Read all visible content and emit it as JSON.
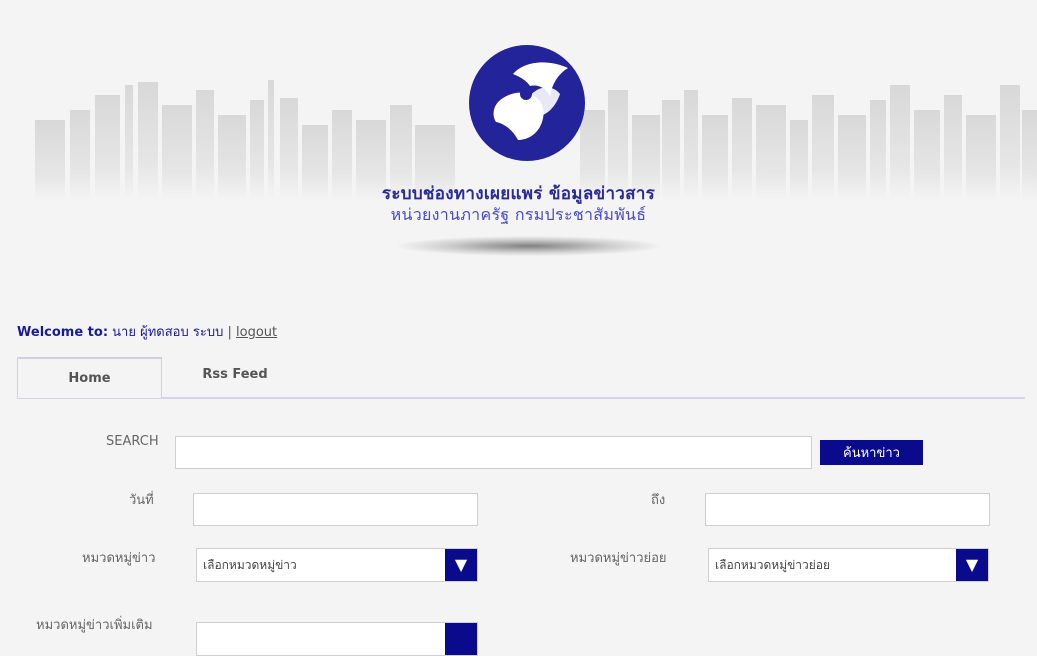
{
  "header": {
    "title_line1": "ระบบช่องทางเผยแพร่ ข้อมูลข่าวสาร",
    "title_line2": "หน่วยงานภาครัฐ กรมประชาสัมพันธ์",
    "brand_color": "#23239a"
  },
  "welcome": {
    "label": "Welcome to:",
    "user": "นาย ผู้ทดสอบ ระบบ",
    "separator": "|",
    "logout": "logout"
  },
  "tabs": [
    {
      "label": "Home",
      "active": true
    },
    {
      "label": "Rss Feed",
      "active": false
    }
  ],
  "search": {
    "label": "SEARCH",
    "value": "",
    "button_label": "ค้นหาข่าว"
  },
  "date": {
    "from_label": "วันที่",
    "from_value": "",
    "to_label": "ถึง",
    "to_value": ""
  },
  "category": {
    "label": "หมวดหมู่ข่าว",
    "selected": "เลือกหมวดหมู่ข่าว"
  },
  "subcategory": {
    "label": "หมวดหมู่ข่าวย่อย",
    "selected": "เลือกหมวดหมู่ข่าวย่อย"
  },
  "extra": {
    "label": "หมวดหมู่ข่าวเพิ่มเติม"
  },
  "icons": {
    "dropdown": "▼"
  }
}
